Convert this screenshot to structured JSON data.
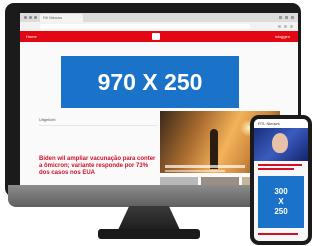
{
  "browser": {
    "tab_title": "Rtl Nieuws"
  },
  "site": {
    "header_left": "Home",
    "header_right": "Inloggen"
  },
  "desktop_ad": {
    "label": "970 X 250"
  },
  "article": {
    "kicker": "Uitgelicht",
    "headline": "Biden wil ampliar vacunação para conter a ômicron; variante responde por 73% dos casos nos EUA"
  },
  "mobile": {
    "header_text": "RTL Nieuws",
    "ad_line1": "300",
    "ad_line2": "X",
    "ad_line3": "250"
  },
  "colors": {
    "brand_red": "#e30613",
    "ad_blue": "#1a73c8",
    "headline_red": "#d0102a"
  }
}
